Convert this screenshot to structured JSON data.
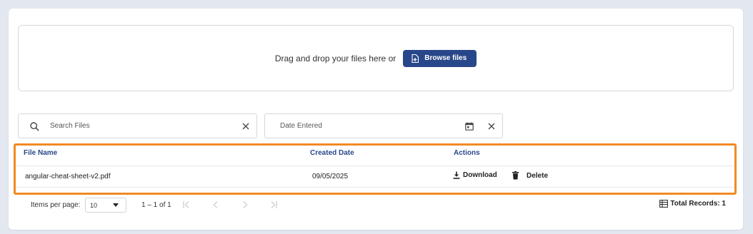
{
  "upload": {
    "prompt": "Drag and drop your files here or",
    "browse_label": "Browse files",
    "browse_icon": "file-add-icon"
  },
  "filters": {
    "search_placeholder": "Search Files",
    "date_placeholder": "Date Entered"
  },
  "table": {
    "columns": [
      "File Name",
      "Created Date",
      "Actions"
    ],
    "rows": [
      {
        "file_name": "angular-cheat-sheet-v2.pdf",
        "created_date": "09/05/2025",
        "download_label": "Download",
        "delete_label": "Delete"
      }
    ]
  },
  "pagination": {
    "items_per_page_label": "Items per page:",
    "page_size": "10",
    "range": "1 – 1 of 1",
    "total_records": "Total Records: 1"
  },
  "colors": {
    "accent": "#28478a",
    "highlight": "#f08a24",
    "background": "#e3e8f0"
  }
}
